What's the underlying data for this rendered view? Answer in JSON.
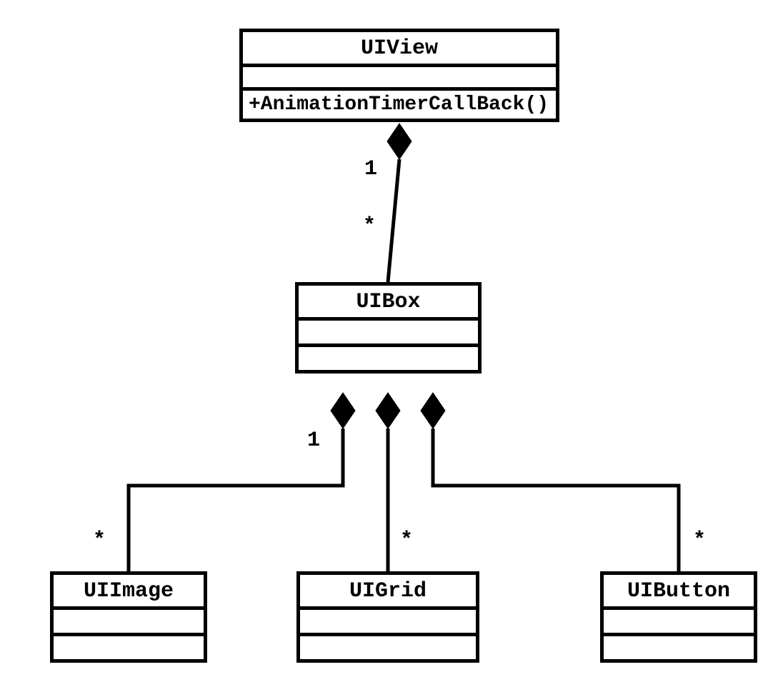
{
  "classes": {
    "uiview": {
      "name": "UIView",
      "operation": "+AnimationTimerCallBack()"
    },
    "uibox": {
      "name": "UIBox"
    },
    "uiimage": {
      "name": "UIImage"
    },
    "uigrid": {
      "name": "UIGrid"
    },
    "uibutton": {
      "name": "UIButton"
    }
  },
  "relations": {
    "uiview_uibox": {
      "type": "composition",
      "whole": "UIView",
      "part": "UIBox",
      "whole_mult": "1",
      "part_mult": "*"
    },
    "uibox_children": {
      "type": "composition",
      "whole": "UIBox",
      "whole_mult": "1",
      "parts": [
        {
          "class": "UIImage",
          "part_mult": "*"
        },
        {
          "class": "UIGrid",
          "part_mult": "*"
        },
        {
          "class": "UIButton",
          "part_mult": "*"
        }
      ]
    }
  }
}
